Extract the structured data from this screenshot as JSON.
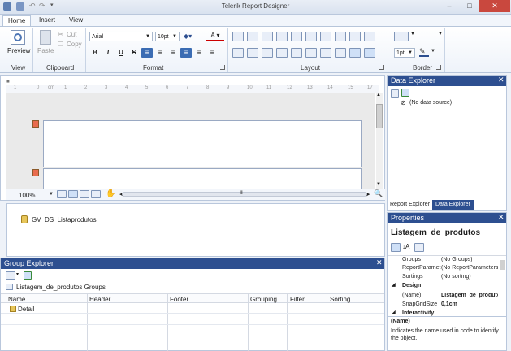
{
  "window": {
    "title": "Telerik Report Designer",
    "minimize": "–",
    "maximize": "□",
    "close": "✕"
  },
  "menu_tabs": [
    "Home",
    "Insert",
    "View"
  ],
  "ribbon": {
    "view_group": {
      "preview_label": "Preview",
      "label": "View"
    },
    "clipboard_group": {
      "paste_label": "Paste",
      "cut_label": "Cut",
      "copy_label": "Copy",
      "label": "Clipboard"
    },
    "format_group": {
      "font_value": "Arial",
      "size_value": "10pt",
      "bold": "B",
      "italic": "I",
      "underline": "U",
      "strike": "S",
      "label": "Format"
    },
    "layout_group": {
      "label": "Layout"
    },
    "border_group": {
      "width_value": "1pt",
      "label": "Border"
    }
  },
  "design": {
    "ruler_marks": [
      "1",
      "0",
      "cm",
      "1",
      "2",
      "3",
      "4",
      "5",
      "6",
      "7",
      "8",
      "9",
      "10",
      "11",
      "12",
      "13",
      "14",
      "15",
      "16",
      "17"
    ],
    "zoom_value": "100%"
  },
  "tray": {
    "datasource_label": "GV_DS_Listaprodutos"
  },
  "group_explorer": {
    "title": "Group Explorer",
    "groups_label": "Listagem_de_produtos Groups",
    "columns": [
      "Name",
      "Header",
      "Footer",
      "Grouping",
      "Filter",
      "Sorting"
    ],
    "rows": [
      {
        "name": "Detail"
      }
    ]
  },
  "data_explorer": {
    "title": "Data Explorer",
    "tree_item": "(No data source)",
    "tabs": [
      "Report Explorer",
      "Data Explorer"
    ]
  },
  "properties": {
    "title": "Properties",
    "object_name": "Listagem_de_produtos",
    "rows": [
      {
        "key": "Groups",
        "value": "(No Groups)"
      },
      {
        "key": "ReportParamet",
        "value": "(No ReportParameters)"
      },
      {
        "key": "Sortings",
        "value": "(No sorting)"
      }
    ],
    "design_category": "Design",
    "design_rows": [
      {
        "key": "(Name)",
        "value": "Listagem_de_produtos"
      },
      {
        "key": "SnapGridSize",
        "value": "0,1cm"
      }
    ],
    "interactivity_category": "Interactivity",
    "desc_title": "(Name)",
    "desc_text": "Indicates the name used in code to identify the object."
  },
  "colors": {
    "panel_header": "#2d4f90",
    "accent": "#3b6cb3"
  }
}
